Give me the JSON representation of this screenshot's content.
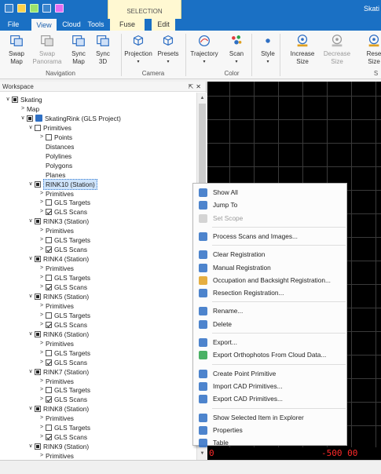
{
  "app": {
    "title": "Skati"
  },
  "context_group": "SELECTION",
  "tabs": [
    {
      "label": "File"
    },
    {
      "label": "View",
      "active": true
    },
    {
      "label": "Cloud"
    },
    {
      "label": "Tools"
    },
    {
      "label": "Fuse",
      "contextual": true
    },
    {
      "label": "Edit",
      "contextual": true
    }
  ],
  "ribbon": {
    "buttons": [
      {
        "label": "Swap\nMap",
        "icon": "swap-map-icon"
      },
      {
        "label": "Swap\nPanorama",
        "icon": "swap-panorama-icon",
        "disabled": true
      },
      {
        "label": "Sync\nMap",
        "icon": "sync-map-icon"
      },
      {
        "label": "Sync\n3D",
        "icon": "sync-3d-icon"
      },
      {
        "label": "Projection",
        "icon": "projection-cube-icon",
        "dropdown": true
      },
      {
        "label": "Presets",
        "icon": "presets-cube-icon",
        "dropdown": true
      },
      {
        "label": "Trajectory",
        "icon": "trajectory-icon",
        "dropdown": true
      },
      {
        "label": "Scan",
        "icon": "scan-icon",
        "dropdown": true
      },
      {
        "label": "Style",
        "icon": "style-dot-icon",
        "dropdown": true
      },
      {
        "label": "Increase\nSize",
        "icon": "increase-size-icon"
      },
      {
        "label": "Decrease\nSize",
        "icon": "decrease-size-icon",
        "disabled": true
      },
      {
        "label": "Rese\nSize",
        "icon": "reset-size-icon"
      }
    ],
    "groups": [
      "Navigation",
      "Camera",
      "Color",
      "S"
    ]
  },
  "workspace": {
    "title": "Workspace",
    "pin_icon": "pin-icon",
    "close_icon": "close-icon",
    "tree": [
      {
        "label": "Skating",
        "arrow": "open",
        "check": "fill",
        "indent": 0
      },
      {
        "label": "Map",
        "arrow": "closed",
        "check": "none",
        "indent": 1
      },
      {
        "label": "SkatingRink (GLS Project)",
        "arrow": "open",
        "check": "fill",
        "indent": 1,
        "icon": "project-icon"
      },
      {
        "label": "Primitives",
        "arrow": "open",
        "check": "empty",
        "indent": 2
      },
      {
        "label": "Points",
        "arrow": "closed",
        "check": "empty",
        "indent": 3
      },
      {
        "label": "Distances",
        "arrow": "none",
        "check": "none",
        "indent": 3
      },
      {
        "label": "Polylines",
        "arrow": "none",
        "check": "none",
        "indent": 3
      },
      {
        "label": "Polygons",
        "arrow": "none",
        "check": "none",
        "indent": 3
      },
      {
        "label": "Planes",
        "arrow": "none",
        "check": "none",
        "indent": 3
      },
      {
        "label": "RINK10 (Station)",
        "arrow": "open",
        "check": "fill",
        "indent": 2,
        "selected": true
      },
      {
        "label": "Primitives",
        "arrow": "closed",
        "check": "none",
        "indent": 3
      },
      {
        "label": "GLS Targets",
        "arrow": "closed",
        "check": "empty",
        "indent": 3
      },
      {
        "label": "GLS Scans",
        "arrow": "closed",
        "check": "checked",
        "indent": 3
      },
      {
        "label": "RINK3 (Station)",
        "arrow": "open",
        "check": "fill",
        "indent": 2
      },
      {
        "label": "Primitives",
        "arrow": "closed",
        "check": "none",
        "indent": 3
      },
      {
        "label": "GLS Targets",
        "arrow": "closed",
        "check": "empty",
        "indent": 3
      },
      {
        "label": "GLS Scans",
        "arrow": "closed",
        "check": "checked",
        "indent": 3
      },
      {
        "label": "RINK4 (Station)",
        "arrow": "open",
        "check": "fill",
        "indent": 2
      },
      {
        "label": "Primitives",
        "arrow": "closed",
        "check": "none",
        "indent": 3
      },
      {
        "label": "GLS Targets",
        "arrow": "closed",
        "check": "empty",
        "indent": 3
      },
      {
        "label": "GLS Scans",
        "arrow": "closed",
        "check": "checked",
        "indent": 3
      },
      {
        "label": "RINK5 (Station)",
        "arrow": "open",
        "check": "fill",
        "indent": 2
      },
      {
        "label": "Primitives",
        "arrow": "closed",
        "check": "none",
        "indent": 3
      },
      {
        "label": "GLS Targets",
        "arrow": "closed",
        "check": "empty",
        "indent": 3
      },
      {
        "label": "GLS Scans",
        "arrow": "closed",
        "check": "checked",
        "indent": 3
      },
      {
        "label": "RINK6 (Station)",
        "arrow": "open",
        "check": "fill",
        "indent": 2
      },
      {
        "label": "Primitives",
        "arrow": "closed",
        "check": "none",
        "indent": 3
      },
      {
        "label": "GLS Targets",
        "arrow": "closed",
        "check": "empty",
        "indent": 3
      },
      {
        "label": "GLS Scans",
        "arrow": "closed",
        "check": "checked",
        "indent": 3
      },
      {
        "label": "RINK7 (Station)",
        "arrow": "open",
        "check": "fill",
        "indent": 2
      },
      {
        "label": "Primitives",
        "arrow": "closed",
        "check": "none",
        "indent": 3
      },
      {
        "label": "GLS Targets",
        "arrow": "closed",
        "check": "empty",
        "indent": 3
      },
      {
        "label": "GLS Scans",
        "arrow": "closed",
        "check": "checked",
        "indent": 3
      },
      {
        "label": "RINK8 (Station)",
        "arrow": "open",
        "check": "fill",
        "indent": 2
      },
      {
        "label": "Primitives",
        "arrow": "closed",
        "check": "none",
        "indent": 3
      },
      {
        "label": "GLS Targets",
        "arrow": "closed",
        "check": "empty",
        "indent": 3
      },
      {
        "label": "GLS Scans",
        "arrow": "closed",
        "check": "checked",
        "indent": 3
      },
      {
        "label": "RINK9 (Station)",
        "arrow": "open",
        "check": "fill",
        "indent": 2
      },
      {
        "label": "Primitives",
        "arrow": "closed",
        "check": "none",
        "indent": 3
      }
    ]
  },
  "viewport": {
    "readout_left": "0",
    "readout_right": "-500 00",
    "text_color": "#ff2a2a"
  },
  "context_menu": {
    "items": [
      {
        "label": "Show All",
        "icon": "show-all-icon"
      },
      {
        "label": "Jump To",
        "icon": "jump-to-icon"
      },
      {
        "label": "Set Scope",
        "icon": "set-scope-icon",
        "disabled": true
      },
      {
        "sep": true
      },
      {
        "label": "Process Scans and Images...",
        "icon": "process-scans-icon"
      },
      {
        "sep": true
      },
      {
        "label": "Clear Registration",
        "icon": "clear-registration-icon"
      },
      {
        "label": "Manual Registration",
        "icon": "manual-registration-icon"
      },
      {
        "label": "Occupation and Backsight Registration...",
        "icon": "occupation-backsight-icon"
      },
      {
        "label": "Resection Registration...",
        "icon": "resection-registration-icon"
      },
      {
        "sep": true
      },
      {
        "label": "Rename...",
        "icon": "rename-icon"
      },
      {
        "label": "Delete",
        "icon": "delete-icon"
      },
      {
        "sep": true
      },
      {
        "label": "Export...",
        "icon": "export-icon"
      },
      {
        "label": "Export Orthophotos From Cloud Data...",
        "icon": "export-orthophotos-icon"
      },
      {
        "sep": true
      },
      {
        "label": "Create Point Primitive",
        "icon": "create-point-icon"
      },
      {
        "label": "Import CAD Primitives...",
        "icon": "import-cad-icon"
      },
      {
        "label": "Export CAD Primitives...",
        "icon": "export-cad-icon"
      },
      {
        "sep": true
      },
      {
        "label": "Show Selected Item in Explorer",
        "icon": "show-explorer-icon"
      },
      {
        "label": "Properties",
        "icon": "properties-icon"
      },
      {
        "label": "Table",
        "icon": "table-icon"
      }
    ]
  },
  "colors": {
    "accent": "#1a70c4",
    "icon_blue": "#2e6fc4",
    "icon_grey": "#9a9a9a"
  }
}
